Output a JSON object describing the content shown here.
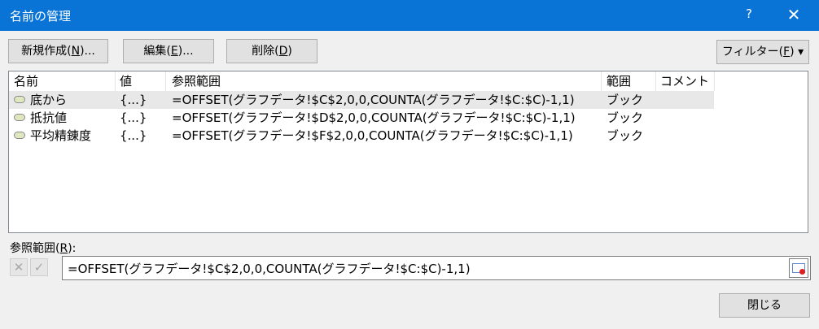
{
  "window": {
    "title": "名前の管理",
    "help_label": "?",
    "close_label": "✕"
  },
  "toolbar": {
    "new_prefix": "新規作成(",
    "new_key": "N",
    "new_suffix": ")...",
    "edit_prefix": "編集(",
    "edit_key": "E",
    "edit_suffix": ")...",
    "delete_prefix": "削除(",
    "delete_key": "D",
    "delete_suffix": ")",
    "filter_prefix": "フィルター(",
    "filter_key": "F",
    "filter_suffix": ")",
    "filter_arrow": "▾"
  },
  "list": {
    "columns": [
      "名前",
      "値",
      "参照範囲",
      "範囲",
      "コメント"
    ],
    "rows": [
      {
        "name": "底から",
        "value": "{...}",
        "ref": "=OFFSET(グラフデータ!$C$2,0,0,COUNTA(グラフデータ!$C:$C)-1,1)",
        "scope": "ブック",
        "comment": ""
      },
      {
        "name": "抵抗値",
        "value": "{...}",
        "ref": "=OFFSET(グラフデータ!$D$2,0,0,COUNTA(グラフデータ!$C:$C)-1,1)",
        "scope": "ブック",
        "comment": ""
      },
      {
        "name": "平均精錬度",
        "value": "{...}",
        "ref": "=OFFSET(グラフデータ!$F$2,0,0,COUNTA(グラフデータ!$C:$C)-1,1)",
        "scope": "ブック",
        "comment": ""
      }
    ]
  },
  "refers": {
    "label_prefix": "参照範囲(",
    "label_key": "R",
    "label_suffix": "):",
    "cancel_glyph": "✕",
    "confirm_glyph": "✓",
    "value": "=OFFSET(グラフデータ!$C$2,0,0,COUNTA(グラフデータ!$C:$C)-1,1)"
  },
  "footer": {
    "close_label": "閉じる"
  },
  "colors": {
    "titlebar": "#0a73d6",
    "selected_row": "#e8e8e8",
    "name_icon": "#dfe7c0"
  }
}
